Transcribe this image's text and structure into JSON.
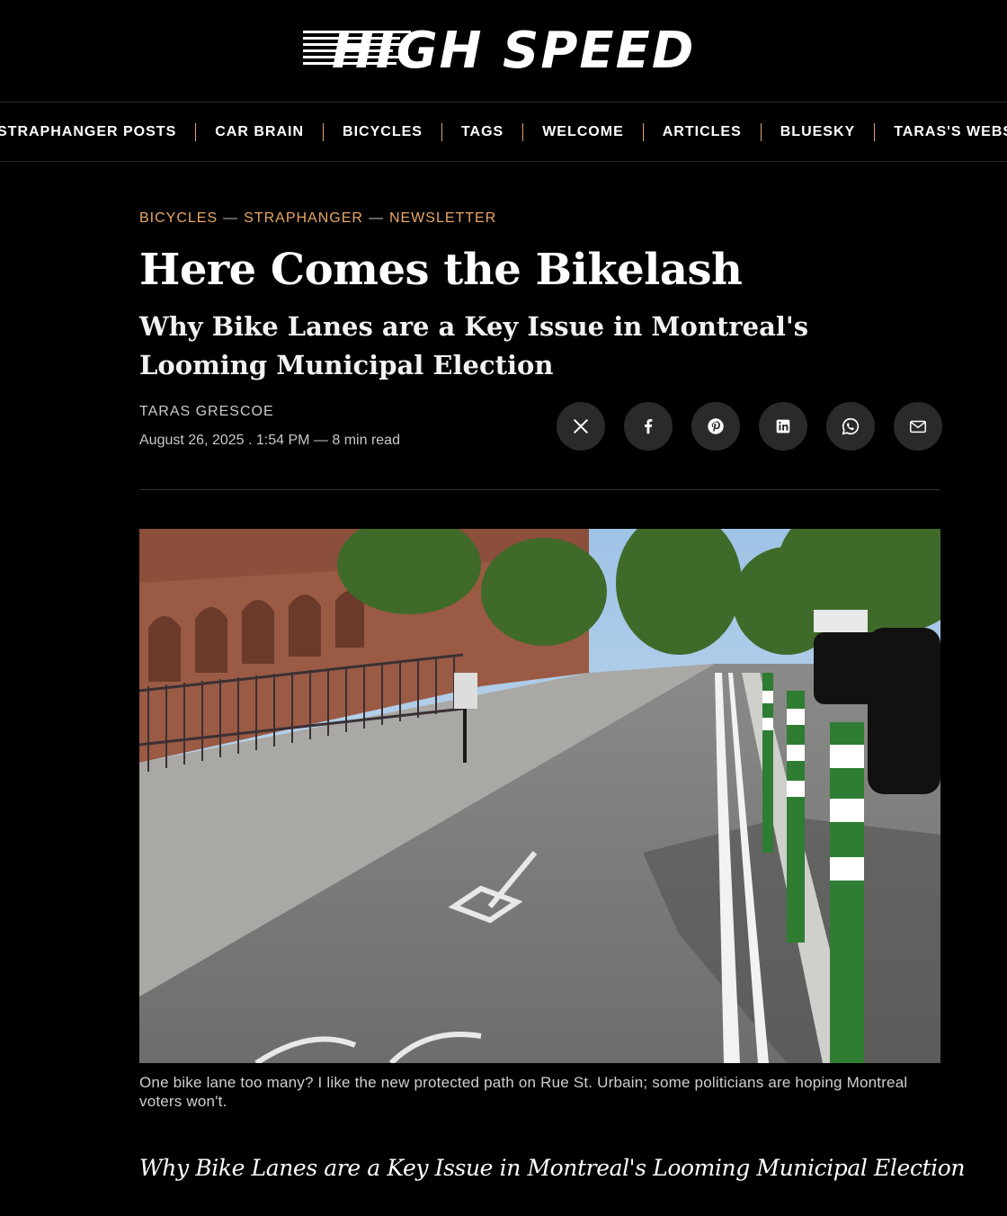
{
  "site": {
    "logo_text": "HIGH SPEED"
  },
  "nav": {
    "items": [
      {
        "label": "STRAPHANGER POSTS"
      },
      {
        "label": "CAR BRAIN"
      },
      {
        "label": "BICYCLES"
      },
      {
        "label": "TAGS"
      },
      {
        "label": "WELCOME"
      },
      {
        "label": "ARTICLES"
      },
      {
        "label": "BLUESKY"
      },
      {
        "label": "TARAS'S WEBSITE"
      }
    ]
  },
  "article": {
    "tags": [
      "BICYCLES",
      "STRAPHANGER",
      "NEWSLETTER"
    ],
    "tag_separator": "—",
    "title": "Here Comes the Bikelash",
    "subtitle": "Why Bike Lanes are a Key Issue in Montreal's Looming Municipal Election",
    "author": "TARAS GRESCOE",
    "date": "August 26, 2025 . 1:54 PM",
    "read_sep": "—",
    "read_time": "8 min read",
    "caption": "One bike lane too many? I like the new protected path on Rue St. Urbain; some politicians are hoping Montreal voters won't.",
    "lede": "Why Bike Lanes are a Key Issue in Montreal's Looming Municipal Election"
  },
  "share": [
    {
      "icon": "x-icon"
    },
    {
      "icon": "facebook-icon"
    },
    {
      "icon": "pinterest-icon"
    },
    {
      "icon": "linkedin-icon"
    },
    {
      "icon": "whatsapp-icon"
    },
    {
      "icon": "email-icon"
    }
  ],
  "colors": {
    "accent": "#e8a766",
    "background": "#000000",
    "share_bg": "#2a2a2a"
  }
}
